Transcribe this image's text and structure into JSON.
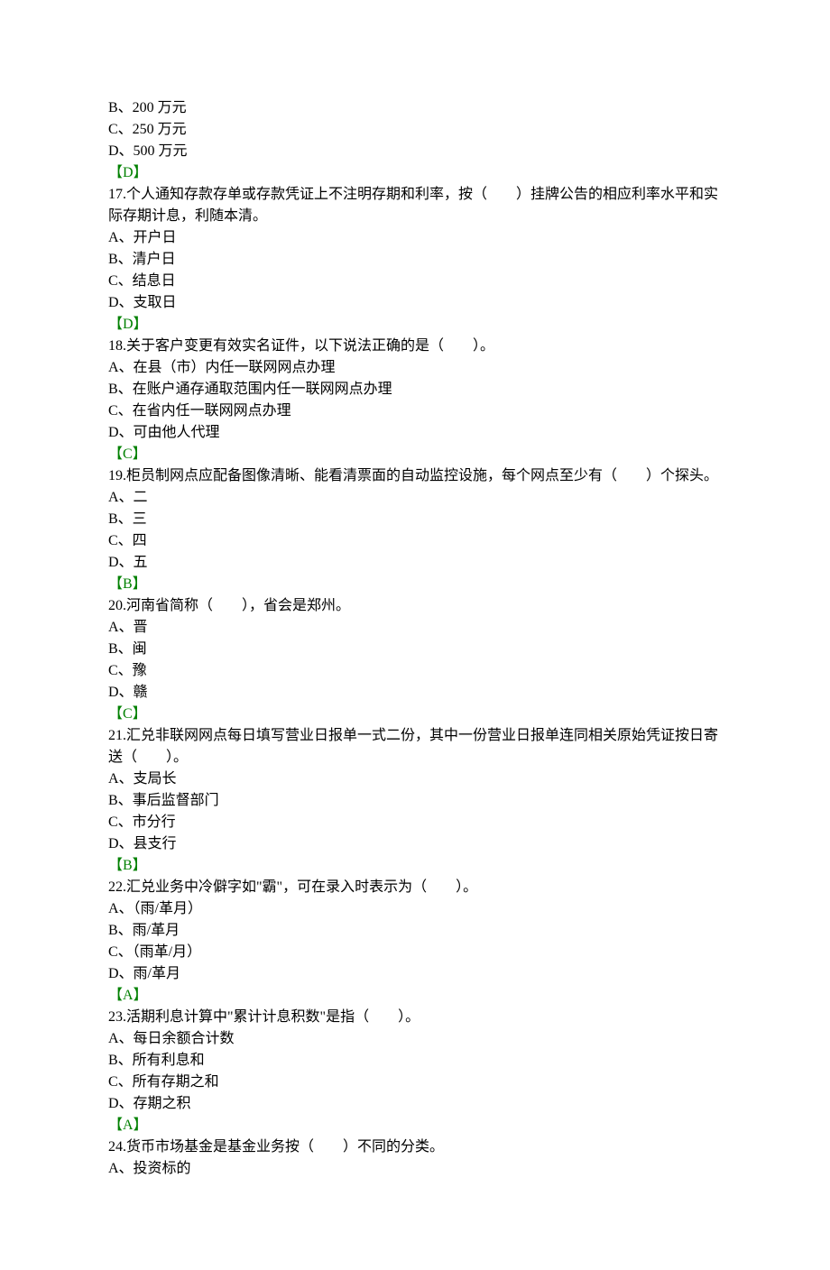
{
  "lines": [
    {
      "text": "B、200 万元",
      "cls": ""
    },
    {
      "text": "C、250 万元",
      "cls": ""
    },
    {
      "text": "D、500 万元",
      "cls": ""
    },
    {
      "text": "【D】",
      "cls": "answer"
    },
    {
      "text": "17.个人通知存款存单或存款凭证上不注明存期和利率，按（　　）挂牌公告的相应利率水平和实际存期计息，利随本清。",
      "cls": ""
    },
    {
      "text": "A、开户日",
      "cls": ""
    },
    {
      "text": "B、清户日",
      "cls": ""
    },
    {
      "text": "C、结息日",
      "cls": ""
    },
    {
      "text": "D、支取日",
      "cls": ""
    },
    {
      "text": "【D】",
      "cls": "answer"
    },
    {
      "text": "18.关于客户变更有效实名证件，以下说法正确的是（　　）。",
      "cls": ""
    },
    {
      "text": "A、在县（市）内任一联网网点办理",
      "cls": ""
    },
    {
      "text": "B、在账户通存通取范围内任一联网网点办理",
      "cls": ""
    },
    {
      "text": "C、在省内任一联网网点办理",
      "cls": ""
    },
    {
      "text": "D、可由他人代理",
      "cls": ""
    },
    {
      "text": "【C】",
      "cls": "answer"
    },
    {
      "text": "19.柜员制网点应配备图像清晰、能看清票面的自动监控设施，每个网点至少有（　　）个探头。",
      "cls": ""
    },
    {
      "text": "A、二",
      "cls": ""
    },
    {
      "text": "B、三",
      "cls": ""
    },
    {
      "text": "C、四",
      "cls": ""
    },
    {
      "text": "D、五",
      "cls": ""
    },
    {
      "text": "【B】",
      "cls": "answer"
    },
    {
      "text": "20.河南省简称（　　），省会是郑州。",
      "cls": ""
    },
    {
      "text": "A、晋",
      "cls": ""
    },
    {
      "text": "B、闽",
      "cls": ""
    },
    {
      "text": "C、豫",
      "cls": ""
    },
    {
      "text": "D、赣",
      "cls": ""
    },
    {
      "text": "【C】",
      "cls": "answer"
    },
    {
      "text": "21.汇兑非联网网点每日填写营业日报单一式二份，其中一份营业日报单连同相关原始凭证按日寄送（　　）。",
      "cls": ""
    },
    {
      "text": "A、支局长",
      "cls": ""
    },
    {
      "text": "B、事后监督部门",
      "cls": ""
    },
    {
      "text": "C、市分行",
      "cls": ""
    },
    {
      "text": "D、县支行",
      "cls": ""
    },
    {
      "text": "【B】",
      "cls": "answer"
    },
    {
      "text": "22.汇兑业务中冷僻字如\"霸\"，可在录入时表示为（　　）。",
      "cls": ""
    },
    {
      "text": "A、（雨/革月）",
      "cls": ""
    },
    {
      "text": "B、雨/革月",
      "cls": ""
    },
    {
      "text": "C、（雨革/月）",
      "cls": ""
    },
    {
      "text": "D、雨/革月",
      "cls": ""
    },
    {
      "text": "【A】",
      "cls": "answer"
    },
    {
      "text": "23.活期利息计算中\"累计计息积数\"是指（　　）。",
      "cls": ""
    },
    {
      "text": "A、每日余额合计数",
      "cls": ""
    },
    {
      "text": "B、所有利息和",
      "cls": ""
    },
    {
      "text": "C、所有存期之和",
      "cls": ""
    },
    {
      "text": "D、存期之积",
      "cls": ""
    },
    {
      "text": "【A】",
      "cls": "answer"
    },
    {
      "text": "24.货币市场基金是基金业务按（　　）不同的分类。",
      "cls": ""
    },
    {
      "text": "A、投资标的",
      "cls": ""
    }
  ]
}
